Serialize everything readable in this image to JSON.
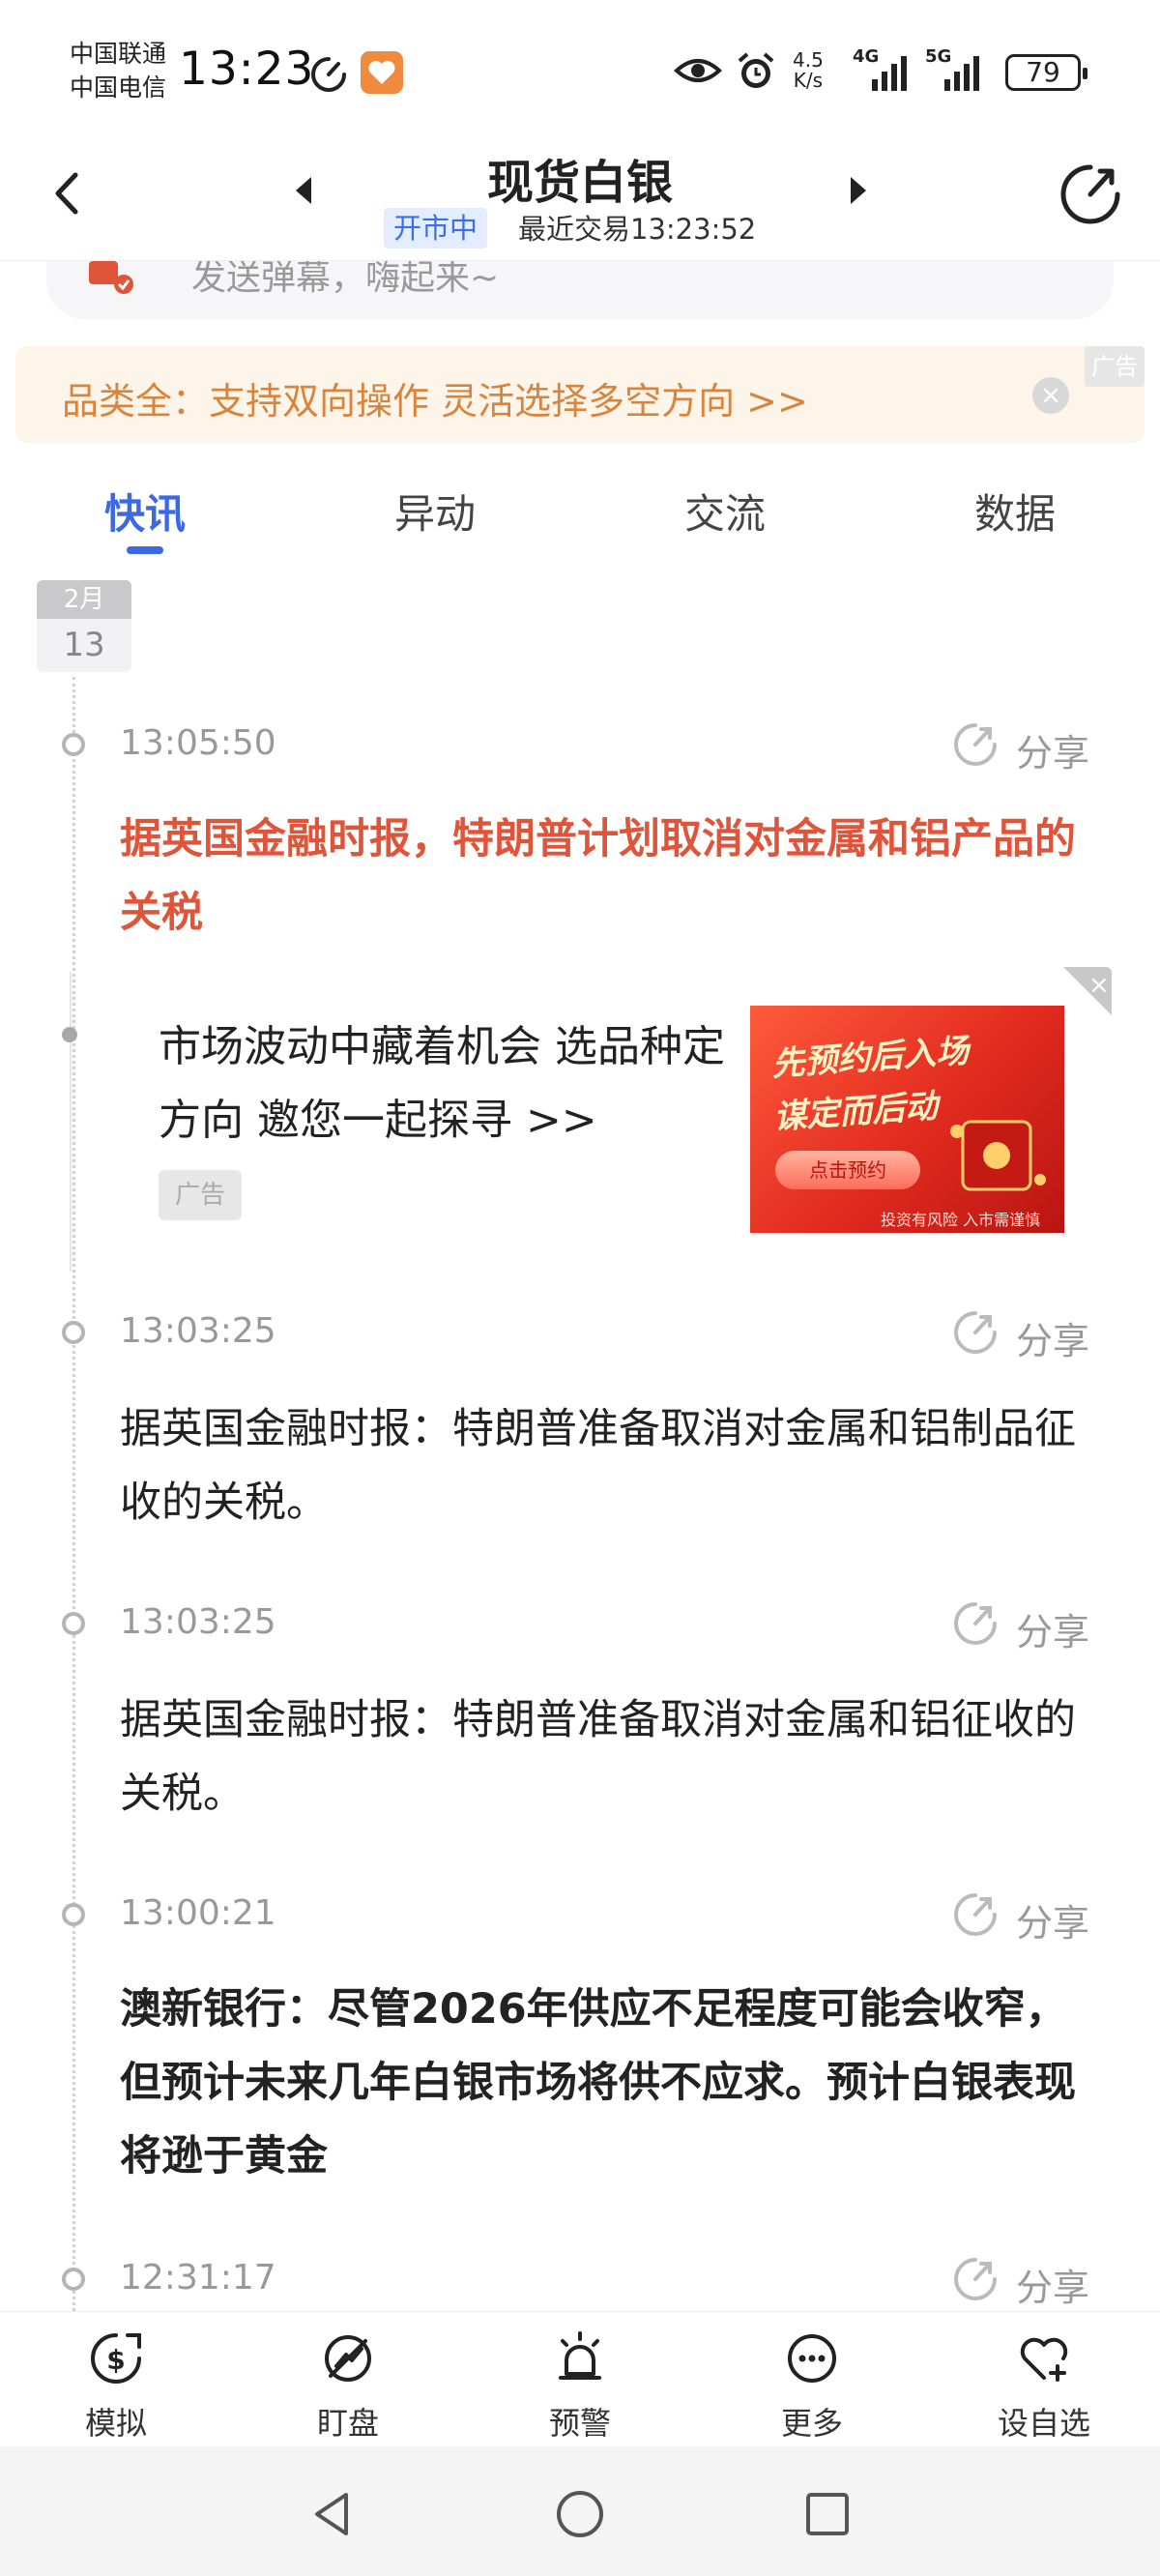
{
  "status_bar": {
    "carrier_1": "中国联通",
    "carrier_2": "中国电信",
    "time": "13:23",
    "speed_value": "4.5",
    "speed_unit": "K/s",
    "network_1": "4G",
    "network_2": "5G",
    "battery": "79"
  },
  "header": {
    "title": "现货白银",
    "market_status": "开市中",
    "last_trade": "最近交易13:23:52"
  },
  "danmaku": {
    "placeholder": "发送弹幕，嗨起来~"
  },
  "ad_banner": {
    "text": "品类全：支持双向操作 灵活选择多空方向 >>",
    "badge": "广告",
    "close": "×"
  },
  "tabs": [
    {
      "label": "快讯",
      "active": true
    },
    {
      "label": "异动",
      "active": false
    },
    {
      "label": "交流",
      "active": false
    },
    {
      "label": "数据",
      "active": false
    }
  ],
  "date_tag": {
    "month": "2月",
    "day": "13"
  },
  "share_label": "分享",
  "news": [
    {
      "time": "13:05:50",
      "text": "据英国金融时报，特朗普计划取消对金属和铝产品的关税",
      "style": "red"
    },
    {
      "time": "13:03:25",
      "text": "据英国金融时报：特朗普准备取消对金属和铝制品征收的关税。",
      "style": "normal"
    },
    {
      "time": "13:03:25",
      "text": "据英国金融时报：特朗普准备取消对金属和铝征收的关税。",
      "style": "normal"
    },
    {
      "time": "13:00:21",
      "text": "澳新银行：尽管2026年供应不足程度可能会收窄，但预计未来几年白银市场将供不应求。预计白银表现将逊于黄金",
      "style": "bold"
    },
    {
      "time": "12:31:17",
      "text": "",
      "style": "normal"
    }
  ],
  "ad_card": {
    "text": "市场波动中藏着机会 选品种定方向 邀您一起探寻 >>",
    "badge": "广告",
    "image_line_1": "先预约后入场",
    "image_line_2": "谋定而后动",
    "image_button": "点击预约",
    "image_footer": "投资有风险 入市需谨慎",
    "close": "×"
  },
  "toolbar": [
    {
      "label": "模拟",
      "icon": "dollar-cycle-icon"
    },
    {
      "label": "盯盘",
      "icon": "target-icon"
    },
    {
      "label": "预警",
      "icon": "alarm-icon"
    },
    {
      "label": "更多",
      "icon": "more-icon"
    },
    {
      "label": "设自选",
      "icon": "heart-add-icon"
    }
  ],
  "colors": {
    "accent": "#3b69e0",
    "highlight_news": "#e0553a",
    "ad_text": "#d9843a"
  }
}
